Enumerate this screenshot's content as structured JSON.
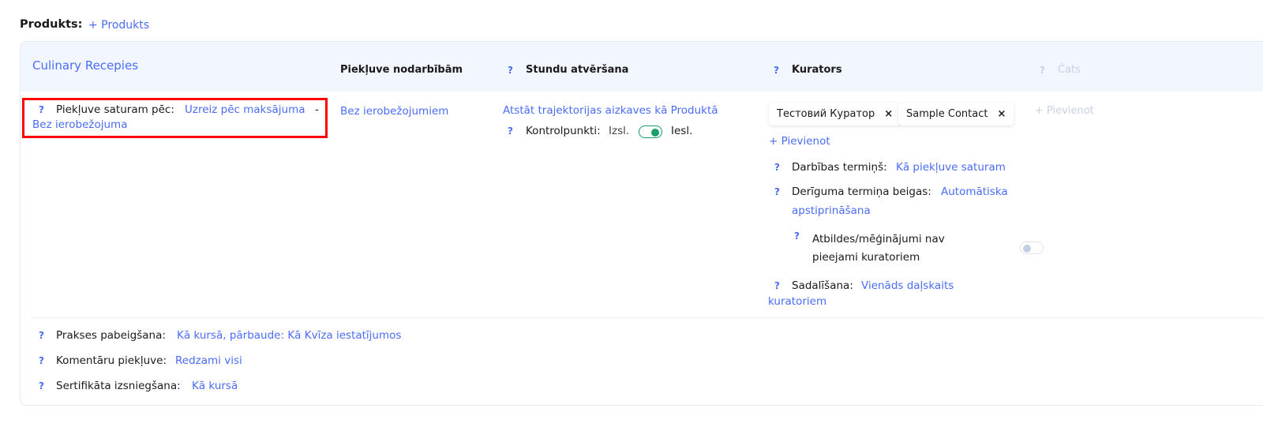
{
  "section": {
    "label": "Produkts:",
    "add_link": "+ Produkts"
  },
  "header": {
    "product": "Culinary Recepies",
    "col_access": "Piekļuve nodarbībām",
    "col_lessons": "Stundu atvēršana",
    "col_curators": "Kurators",
    "col_chat": "Čats"
  },
  "help": "?",
  "row": {
    "content_access_label": "Piekļuve saturam pēc:",
    "content_access_value": "Uzreiz pēc maksājuma",
    "sep": "-",
    "content_access_limit": "Bez ierobežojuma",
    "lessons_access": "Bez ierobežojumiem",
    "trajectory": "Atstāt trajektorijas aizkaves kā Produktā",
    "checkpoints_label": "Kontrolpunkti:",
    "off": "Izsl.",
    "on": "Iesl.",
    "checkpoints_enabled": true,
    "curators": [
      {
        "name": "Тестовий Куратор"
      },
      {
        "name": "Sample Contact"
      }
    ],
    "remove": "×",
    "add_curator": "+ Pievienot",
    "term_label": "Darbības termiņš:",
    "term_value": "Kā piekļuve saturam",
    "expiry_label": "Derīguma termiņa beigas:",
    "expiry_value_1": "Automātiska",
    "expiry_value_2": "apstiprināšana",
    "answers_label_1": "Atbildes/mēģinājumi nav",
    "answers_label_2": "pieejami kuratoriem",
    "answers_enabled": false,
    "split_label": "Sadalīšana:",
    "split_value_1": "Vienāds daļskaits",
    "split_value_2": "kuratoriem",
    "add_chat": "+ Pievienot"
  },
  "footer": {
    "practice_label": "Prakses pabeigšana:",
    "practice_value": "Kā kursā, pārbaude: Kā Kvīza iestatījumos",
    "comments_label": "Komentāru piekļuve:",
    "comments_value": "Redzami visi",
    "cert_label": "Sertifikāta izsniegšana:",
    "cert_value": "Kā kursā"
  },
  "colors": {
    "accent": "#4a6cf7",
    "highlight": "#ff0000",
    "toggle_on": "#1a9e6a"
  }
}
